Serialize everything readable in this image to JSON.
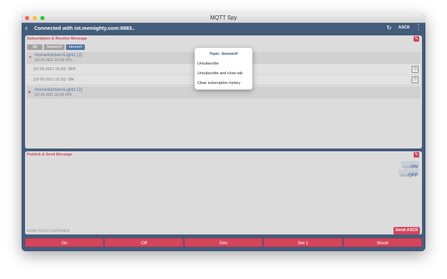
{
  "window": {
    "title": "MQTT Spy"
  },
  "navbar": {
    "title": "Connected with iot.memighty.com:8883..",
    "mode_label": "ASCII"
  },
  "subscription": {
    "title": "Subscription & Receive Message",
    "tabs": [
      "All",
      "Sensor/#",
      "Home/#"
    ],
    "groups": [
      {
        "topic": "Home/kitchen/Light1 [2]",
        "last": "[22-05-2021 18:32] OFF",
        "messages": [
          {
            "time": "[22-05-2021 18:32]",
            "value": "OFF"
          },
          {
            "time": "[22-05-2021 18:32]",
            "value": "ON"
          }
        ]
      },
      {
        "topic": "Home/kitchen/Light2 [2]",
        "last": "[22-05-2021 18:32] OFF"
      }
    ]
  },
  "publish": {
    "title": "Publish & Send Message",
    "badges": [
      {
        "format": "ASCII",
        "value": "ON"
      },
      {
        "format": "ASCII",
        "value": "OFF"
      }
    ],
    "input_placeholder": "Enter ASCII Command",
    "send_label": "Send ASCII"
  },
  "presets": [
    "On",
    "Off",
    "Dim",
    "Set 1",
    "Mood"
  ],
  "popup": {
    "title": "Topic: Sensor/#",
    "items": [
      "Unsubscribe",
      "Unsubscribe and close tab",
      "Clear subscription history"
    ]
  },
  "colors": {
    "navy": "#0f2f57",
    "accent_red": "#c8102e",
    "link_blue": "#1f4e8c"
  }
}
